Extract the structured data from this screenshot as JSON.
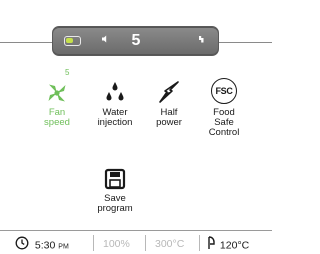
{
  "stepper": {
    "toggle_state": "on",
    "toggle_level": 0.55,
    "value": "5",
    "decrease_icon": "volume-down-icon",
    "increase_icon": "volume-up-icon"
  },
  "options": [
    {
      "label": "Fan\nspeed",
      "badge": "5",
      "icon": "fan-icon",
      "color": "#6fbf5a"
    },
    {
      "label": "Water\ninjection",
      "icon": "water-drops-icon",
      "color": "#1a1a1a"
    },
    {
      "label": "Half\npower",
      "icon": "lightning-icon",
      "color": "#1a1a1a"
    },
    {
      "label": "Food\nSafe\nControl",
      "icon_text": "FSC",
      "icon": "fsc-icon",
      "color": "#1a1a1a"
    },
    {
      "label": "Save\nprogram",
      "icon": "floppy-disk-icon",
      "color": "#1a1a1a"
    }
  ],
  "status_bar": {
    "time": "5:30",
    "time_suffix": "PM",
    "power": "100%",
    "set_temp": "300°C",
    "probe_temp": "120°C"
  },
  "colors": {
    "accent_green": "#6fbf5a",
    "bar_gray": "#7a7a7a",
    "toggle_lime": "#c6e14b",
    "muted_text": "#b8b8b8"
  }
}
